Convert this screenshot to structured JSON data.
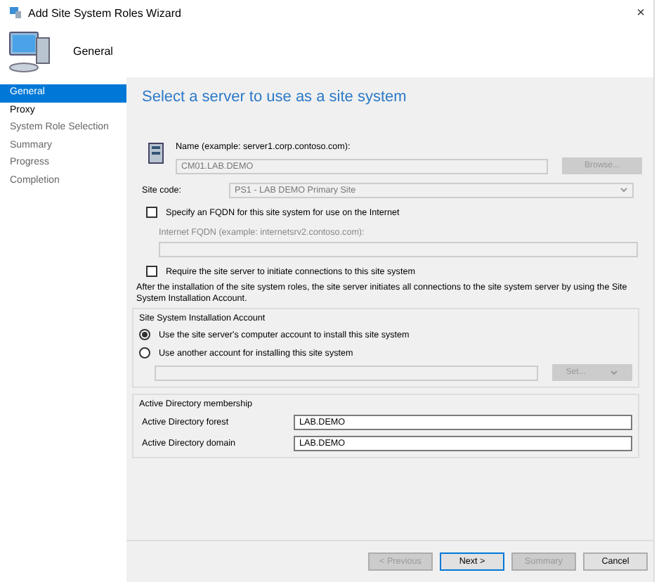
{
  "window": {
    "title": "Add Site System Roles Wizard",
    "close": "×"
  },
  "header": {
    "title": "General"
  },
  "sidebar": {
    "items": [
      {
        "label": "General",
        "selected": true,
        "disabled": false
      },
      {
        "label": "Proxy",
        "selected": false,
        "disabled": false
      },
      {
        "label": "System Role Selection",
        "selected": false,
        "disabled": true
      },
      {
        "label": "Summary",
        "selected": false,
        "disabled": true
      },
      {
        "label": "Progress",
        "selected": false,
        "disabled": true
      },
      {
        "label": "Completion",
        "selected": false,
        "disabled": true
      }
    ]
  },
  "page": {
    "heading": "Select a server to use as a site system",
    "name_label": "Name (example: server1.corp.contoso.com):",
    "name_value": "CM01.LAB.DEMO",
    "browse": "Browse...",
    "site_code_label": "Site code:",
    "site_code_value": "PS1 - LAB DEMO Primary Site",
    "fqdn_checkbox": {
      "label": "Specify an FQDN for this site system for use on the Internet",
      "checked": false
    },
    "fqdn_label": "Internet FQDN (example: internetsrv2.contoso.com):",
    "require_checkbox": {
      "label": "Require the site server to initiate connections to this site system",
      "checked": false
    },
    "require_note": "After the  installation of the site system roles, the site server initiates all connections to the site system server by using the Site System Installation Account.",
    "install_account": {
      "title": "Site System Installation Account",
      "options": [
        {
          "label": "Use the site server's computer account to install this site system",
          "selected": true
        },
        {
          "label": "Use another account for installing this site system",
          "selected": false
        }
      ],
      "set": "Set..."
    },
    "ad": {
      "title": "Active Directory membership",
      "fields": [
        {
          "label": "Active Directory forest",
          "value": "LAB.DEMO"
        },
        {
          "label": "Active Directory domain",
          "value": "LAB.DEMO"
        }
      ]
    }
  },
  "buttons": [
    {
      "label": "< Previous",
      "disabled": true,
      "default": false
    },
    {
      "label": "Next >",
      "disabled": false,
      "default": true
    },
    {
      "label": "Summary",
      "disabled": true,
      "default": false
    },
    {
      "label": "Cancel",
      "disabled": false,
      "default": false
    }
  ]
}
